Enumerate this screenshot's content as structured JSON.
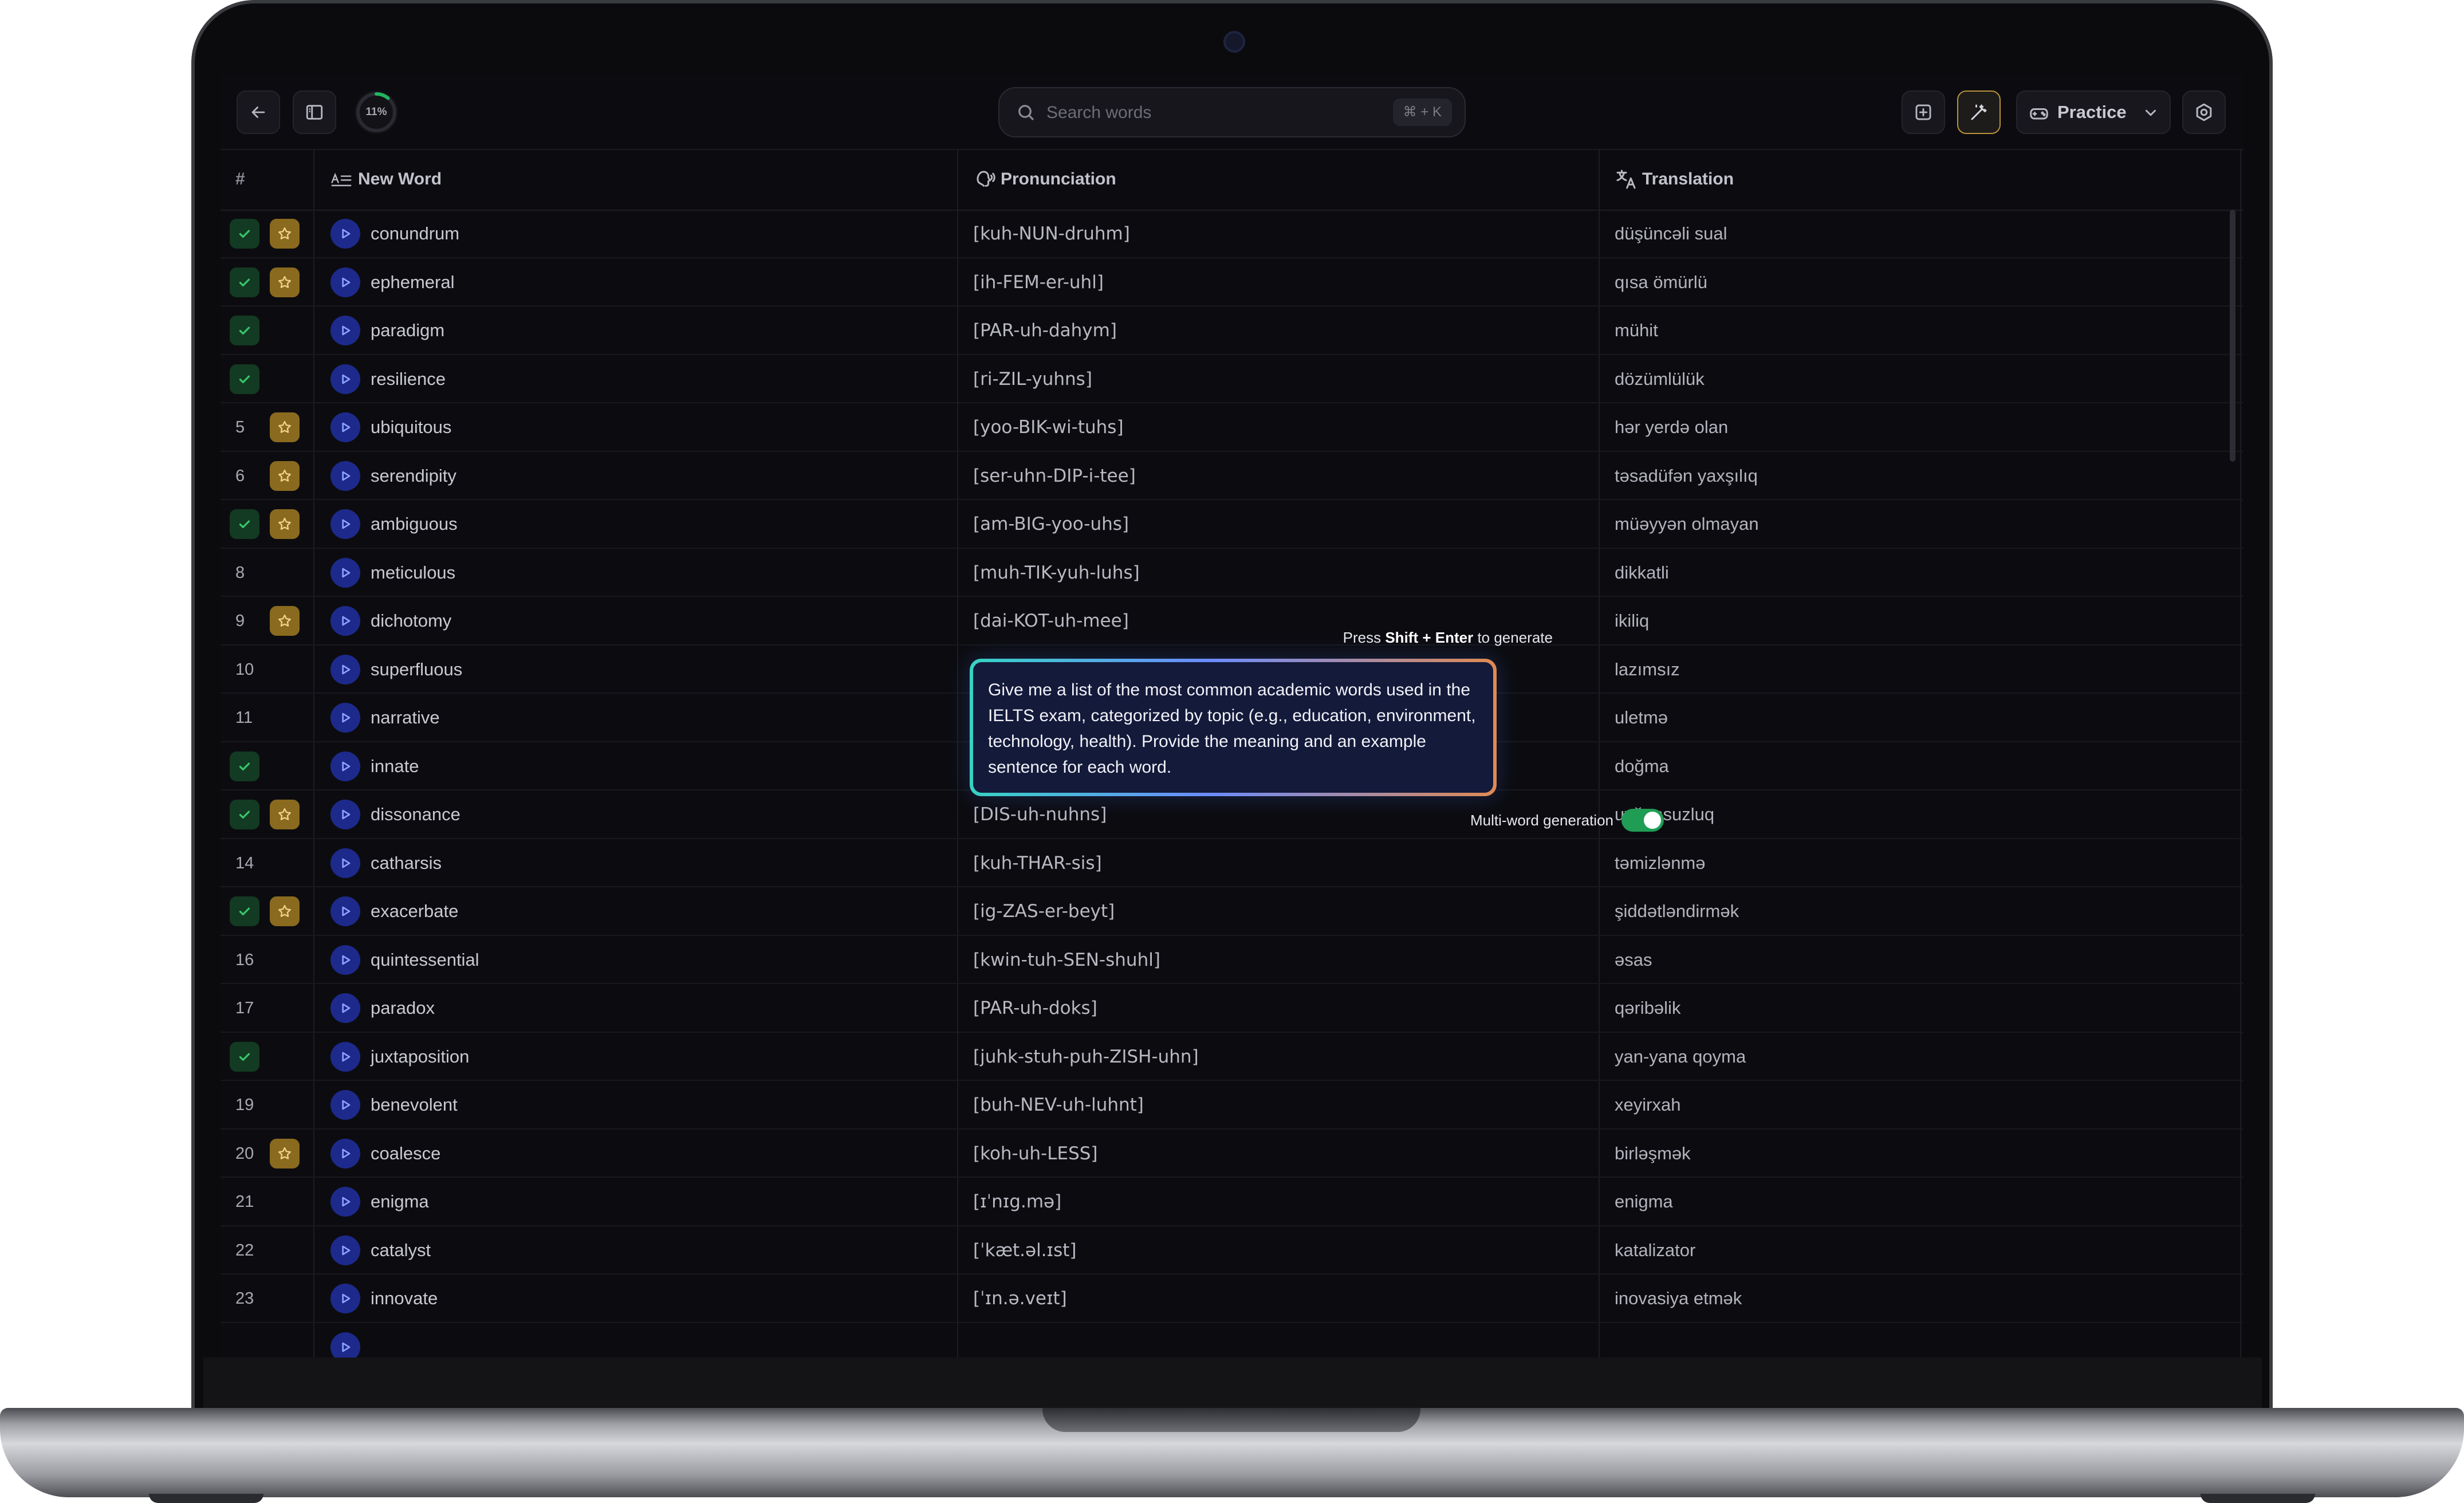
{
  "toolbar": {
    "progress_text": "11%",
    "progress_value": 0.11,
    "search_placeholder": "Search words",
    "search_shortcut": "⌘ + K",
    "practice_label": "Practice"
  },
  "columns": {
    "number": "#",
    "word": "New Word",
    "pronunciation": "Pronunciation",
    "translation": "Translation"
  },
  "rows": [
    {
      "num": "",
      "learned": true,
      "starred": true,
      "word": "conundrum",
      "pron": "[kuh-NUN-druhm]",
      "trans": "düşüncəli sual"
    },
    {
      "num": "",
      "learned": true,
      "starred": true,
      "word": "ephemeral",
      "pron": "[ih-FEM-er-uhl]",
      "trans": "qısa ömürlü"
    },
    {
      "num": "",
      "learned": true,
      "starred": false,
      "word": "paradigm",
      "pron": "[PAR-uh-dahym]",
      "trans": "mühit"
    },
    {
      "num": "",
      "learned": true,
      "starred": false,
      "word": "resilience",
      "pron": "[ri-ZIL-yuhns]",
      "trans": "dözümlülük"
    },
    {
      "num": "5",
      "learned": false,
      "starred": true,
      "word": "ubiquitous",
      "pron": "[yoo-BIK-wi-tuhs]",
      "trans": "hər yerdə olan"
    },
    {
      "num": "6",
      "learned": false,
      "starred": true,
      "word": "serendipity",
      "pron": "[ser-uhn-DIP-i-tee]",
      "trans": "təsadüfən yaxşılıq"
    },
    {
      "num": "",
      "learned": true,
      "starred": true,
      "word": "ambiguous",
      "pron": "[am-BIG-yoo-uhs]",
      "trans": "müəyyən olmayan"
    },
    {
      "num": "8",
      "learned": false,
      "starred": false,
      "word": "meticulous",
      "pron": "[muh-TIK-yuh-luhs]",
      "trans": "dikkatli"
    },
    {
      "num": "9",
      "learned": false,
      "starred": true,
      "word": "dichotomy",
      "pron": "[dai-KOT-uh-mee]",
      "trans": "ikiliq"
    },
    {
      "num": "10",
      "learned": false,
      "starred": false,
      "word": "superfluous",
      "pron": "",
      "trans": "lazımsız"
    },
    {
      "num": "11",
      "learned": false,
      "starred": false,
      "word": "narrative",
      "pron": "",
      "trans": "uletmə"
    },
    {
      "num": "",
      "learned": true,
      "starred": false,
      "word": "innate",
      "pron": "",
      "trans": "doğma"
    },
    {
      "num": "",
      "learned": true,
      "starred": true,
      "word": "dissonance",
      "pron": "[DIS-uh-nuhns]",
      "trans": "uyğunsuzluq"
    },
    {
      "num": "14",
      "learned": false,
      "starred": false,
      "word": "catharsis",
      "pron": "[kuh-THAR-sis]",
      "trans": "təmizlənmə"
    },
    {
      "num": "",
      "learned": true,
      "starred": true,
      "word": "exacerbate",
      "pron": "[ig-ZAS-er-beyt]",
      "trans": "şiddətləndirmək"
    },
    {
      "num": "16",
      "learned": false,
      "starred": false,
      "word": "quintessential",
      "pron": "[kwin-tuh-SEN-shuhl]",
      "trans": "əsas"
    },
    {
      "num": "17",
      "learned": false,
      "starred": false,
      "word": "paradox",
      "pron": "[PAR-uh-doks]",
      "trans": "qəribəlik"
    },
    {
      "num": "",
      "learned": true,
      "starred": false,
      "word": "juxtaposition",
      "pron": "[juhk-stuh-puh-ZISH-uhn]",
      "trans": "yan-yana qoyma"
    },
    {
      "num": "19",
      "learned": false,
      "starred": false,
      "word": "benevolent",
      "pron": "[buh-NEV-uh-luhnt]",
      "trans": "xeyirxah"
    },
    {
      "num": "20",
      "learned": false,
      "starred": true,
      "word": "coalesce",
      "pron": "[koh-uh-LESS]",
      "trans": "birləşmək"
    },
    {
      "num": "21",
      "learned": false,
      "starred": false,
      "word": "enigma",
      "pron": "[ɪˈnɪg.mə]",
      "trans": "enigma"
    },
    {
      "num": "22",
      "learned": false,
      "starred": false,
      "word": "catalyst",
      "pron": "[ˈkæt.əl.ɪst]",
      "trans": "katalizator"
    },
    {
      "num": "23",
      "learned": false,
      "starred": false,
      "word": "innovate",
      "pron": "[ˈɪn.ə.veɪt]",
      "trans": "inovasiya etmək"
    }
  ],
  "ai_prompt": {
    "hint_prefix": "Press",
    "hint_keys": "Shift + Enter",
    "hint_suffix": "to generate",
    "text": "Give me a list of the most common academic words used in the IELTS exam, categorized by topic (e.g., education, environment, technology, health). Provide the meaning and an example sentence for each word.",
    "multi_word_label": "Multi-word generation",
    "multi_word_enabled": true
  },
  "colors": {
    "accent_green": "#1f9d55",
    "star_gold": "#8a6a1e",
    "play_blue": "#1d2a8c",
    "background": "#0c0c10"
  }
}
